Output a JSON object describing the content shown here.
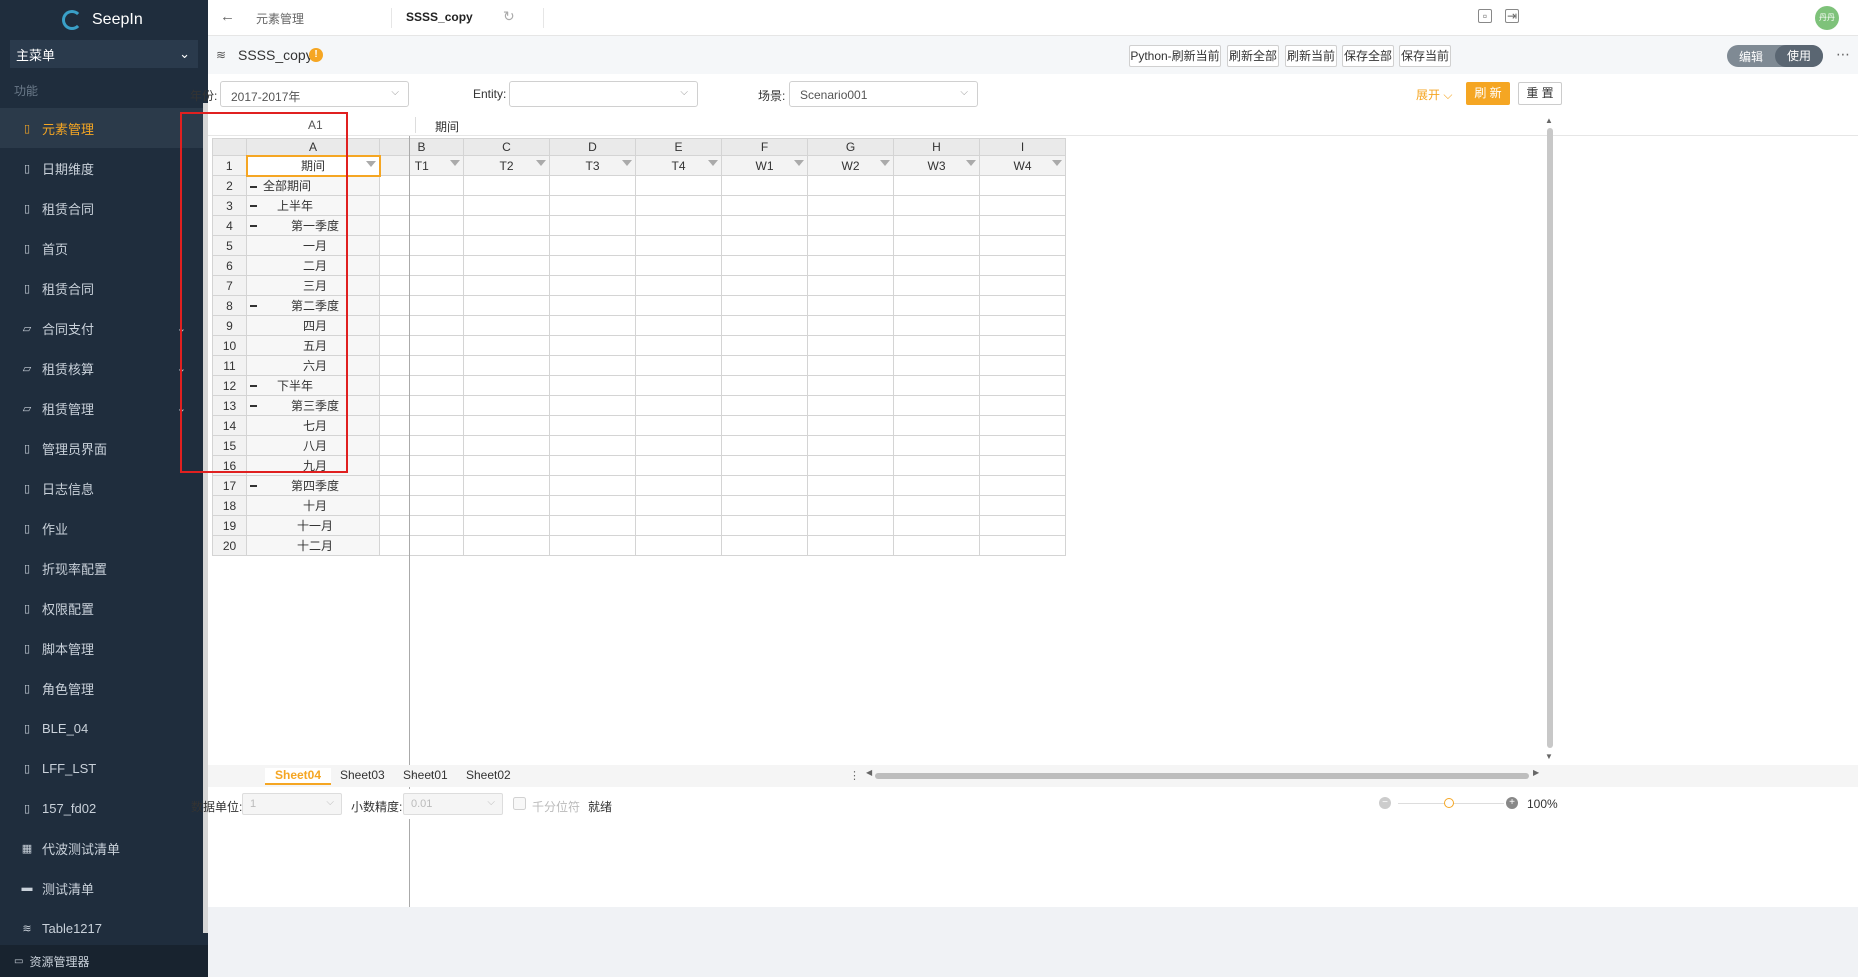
{
  "app": {
    "name": "SeepIn"
  },
  "sidebar": {
    "menu_select": "主菜单",
    "section_label": "功能",
    "items": [
      {
        "label": "元素管理",
        "icon": "doc-icon",
        "active": true,
        "has_children": false
      },
      {
        "label": "日期维度",
        "icon": "doc-icon",
        "active": false,
        "has_children": false
      },
      {
        "label": "租赁合同",
        "icon": "doc-icon",
        "active": false,
        "has_children": false
      },
      {
        "label": "首页",
        "icon": "doc-icon",
        "active": false,
        "has_children": false
      },
      {
        "label": "租赁合同",
        "icon": "doc-icon",
        "active": false,
        "has_children": false
      },
      {
        "label": "合同支付",
        "icon": "folder-icon",
        "active": false,
        "has_children": true
      },
      {
        "label": "租赁核算",
        "icon": "folder-icon",
        "active": false,
        "has_children": true
      },
      {
        "label": "租赁管理",
        "icon": "folder-icon",
        "active": false,
        "has_children": true
      },
      {
        "label": "管理员界面",
        "icon": "doc-icon",
        "active": false,
        "has_children": false
      },
      {
        "label": "日志信息",
        "icon": "doc-icon",
        "active": false,
        "has_children": false
      },
      {
        "label": "作业",
        "icon": "doc-icon",
        "active": false,
        "has_children": false
      },
      {
        "label": "折现率配置",
        "icon": "doc-icon",
        "active": false,
        "has_children": false
      },
      {
        "label": "权限配置",
        "icon": "doc-icon",
        "active": false,
        "has_children": false
      },
      {
        "label": "脚本管理",
        "icon": "doc-icon",
        "active": false,
        "has_children": false
      },
      {
        "label": "角色管理",
        "icon": "doc-icon",
        "active": false,
        "has_children": false
      },
      {
        "label": "BLE_04",
        "icon": "doc-icon",
        "active": false,
        "has_children": false
      },
      {
        "label": "LFF_LST",
        "icon": "doc-icon",
        "active": false,
        "has_children": false
      },
      {
        "label": "157_fd02",
        "icon": "doc-icon",
        "active": false,
        "has_children": false
      },
      {
        "label": "代波测试清单",
        "icon": "grid-icon",
        "active": false,
        "has_children": false
      },
      {
        "label": "测试清单",
        "icon": "folder-filled-icon",
        "active": false,
        "has_children": false
      },
      {
        "label": "Table1217",
        "icon": "layers-icon",
        "active": false,
        "has_children": false
      }
    ],
    "bottom_label": "资源管理器"
  },
  "topbar": {
    "tabs": [
      {
        "label": "元素管理",
        "active": false
      },
      {
        "label": "SSSS_copy",
        "active": true
      }
    ],
    "avatar_text": "丹丹"
  },
  "titlebar": {
    "title": "SSSS_copy",
    "buttons": [
      "Python-刷新当前",
      "刷新全部",
      "刷新当前",
      "保存全部",
      "保存当前"
    ],
    "toggle": {
      "left": "编辑",
      "right": "使用",
      "selected": "使用"
    }
  },
  "filters": {
    "year_label": "年份:",
    "year_value": "2017-2017年",
    "entity_label": "Entity:",
    "entity_value": "",
    "scene_label": "场景:",
    "scene_value": "Scenario001",
    "expand_label": "展开",
    "refresh_label": "刷 新",
    "reset_label": "重 置"
  },
  "sheet": {
    "cell_ref": "A1",
    "formula_value": "期间",
    "columns": [
      "A",
      "B",
      "C",
      "D",
      "E",
      "F",
      "G",
      "H",
      "I"
    ],
    "header_row": [
      "期间",
      "T1",
      "T2",
      "T3",
      "T4",
      "W1",
      "W2",
      "W3",
      "W4"
    ],
    "rows": [
      {
        "num": "2",
        "label": "全部期间",
        "indent": 1,
        "collapsible": true
      },
      {
        "num": "3",
        "label": "上半年",
        "indent": 2,
        "collapsible": true
      },
      {
        "num": "4",
        "label": "第一季度",
        "indent": 3,
        "collapsible": true
      },
      {
        "num": "5",
        "label": "一月",
        "indent": 4,
        "collapsible": false
      },
      {
        "num": "6",
        "label": "二月",
        "indent": 4,
        "collapsible": false
      },
      {
        "num": "7",
        "label": "三月",
        "indent": 4,
        "collapsible": false
      },
      {
        "num": "8",
        "label": "第二季度",
        "indent": 3,
        "collapsible": true
      },
      {
        "num": "9",
        "label": "四月",
        "indent": 4,
        "collapsible": false
      },
      {
        "num": "10",
        "label": "五月",
        "indent": 4,
        "collapsible": false
      },
      {
        "num": "11",
        "label": "六月",
        "indent": 4,
        "collapsible": false
      },
      {
        "num": "12",
        "label": "下半年",
        "indent": 2,
        "collapsible": true
      },
      {
        "num": "13",
        "label": "第三季度",
        "indent": 3,
        "collapsible": true
      },
      {
        "num": "14",
        "label": "七月",
        "indent": 4,
        "collapsible": false
      },
      {
        "num": "15",
        "label": "八月",
        "indent": 4,
        "collapsible": false
      },
      {
        "num": "16",
        "label": "九月",
        "indent": 4,
        "collapsible": false
      },
      {
        "num": "17",
        "label": "第四季度",
        "indent": 3,
        "collapsible": true
      },
      {
        "num": "18",
        "label": "十月",
        "indent": 4,
        "collapsible": false
      },
      {
        "num": "19",
        "label": "十一月",
        "indent": 4,
        "collapsible": false
      },
      {
        "num": "20",
        "label": "十二月",
        "indent": 4,
        "collapsible": false
      }
    ]
  },
  "sheet_tabs": [
    {
      "label": "Sheet04",
      "active": true
    },
    {
      "label": "Sheet03",
      "active": false
    },
    {
      "label": "Sheet01",
      "active": false
    },
    {
      "label": "Sheet02",
      "active": false
    }
  ],
  "statusbar": {
    "data_unit_label": "数据单位:",
    "data_unit_value": "1",
    "decimal_label": "小数精度:",
    "decimal_value": "0.01",
    "thousands_label": "千分位符",
    "status_text": "就绪",
    "zoom": "100%"
  },
  "colors": {
    "accent": "#f5a623",
    "sidebar_bg": "#1f2d3d",
    "highlight_box": "#e02020"
  }
}
